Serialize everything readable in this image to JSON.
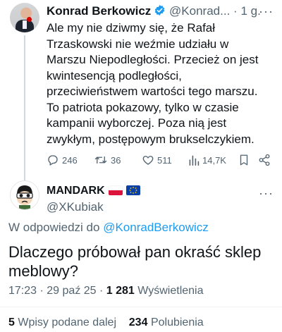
{
  "parent": {
    "author_name": "Konrad Berkowicz",
    "handle": "@Konrad...",
    "separator": "·",
    "time": "1 g.",
    "text": "Ale my nie dziwmy się, że Rafał\nTrzaskowski nie weźmie udziału w\nMarszu Niepodległości. Przecież on jest\nkwintesencją podległości,\nprzeciwieństwem wartości tego marszu.\nTo patriota pokazowy, tylko w czasie\nkampanii wyborczej. Poza nią jest\nzwykłym,  postępowym brukselczykiem.",
    "replies": "246",
    "reposts": "36",
    "likes": "511",
    "views": "14,7K"
  },
  "reply": {
    "author_name": "MANDARK",
    "handle": "@XKubiak",
    "reply_prefix": "W odpowiedzi do",
    "reply_to": "@KonradBerkowicz",
    "text": "Dlaczego próbował pan okraść sklep meblowy?",
    "time": "17:23",
    "date": "· 29 paź 25 ·",
    "view_count": "1 281",
    "view_label": "Wyświetlenia",
    "reposts_count": "5",
    "reposts_label": "Wpisy podane dalej",
    "likes_count": "234",
    "likes_label": "Polubienia"
  },
  "icons": {
    "verified": "verified-badge-icon",
    "more": "more-dots-icon",
    "reply": "reply-icon",
    "repost": "repost-icon",
    "like": "heart-icon",
    "views": "views-chart-icon",
    "bookmark": "bookmark-icon",
    "share": "share-icon",
    "flags": [
      "poland-flag",
      "eu-flag"
    ]
  },
  "colors": {
    "link": "#1d9bf0",
    "muted": "#536471",
    "text": "#0f1419"
  }
}
